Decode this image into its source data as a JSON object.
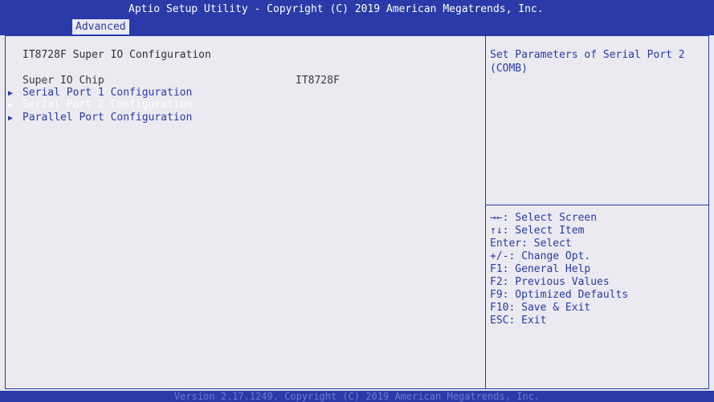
{
  "header": {
    "title": "Aptio Setup Utility - Copyright (C) 2019 American Megatrends, Inc.",
    "active_tab": "Advanced"
  },
  "main": {
    "heading": "IT8728F Super IO Configuration",
    "chip_label": "Super IO Chip",
    "chip_value": "IT8728F",
    "items": [
      {
        "label": "Serial Port 1 Configuration",
        "selected": false
      },
      {
        "label": "Serial Port 2 Configuration",
        "selected": true
      },
      {
        "label": "Parallel Port Configuration",
        "selected": false
      }
    ]
  },
  "help": {
    "text": "Set Parameters of Serial Port 2 (COMB)"
  },
  "keys": [
    "→←: Select Screen",
    "↑↓: Select Item",
    "Enter: Select",
    "+/-: Change Opt.",
    "F1: General Help",
    "F2: Previous Values",
    "F9: Optimized Defaults",
    "F10: Save & Exit",
    "ESC: Exit"
  ],
  "footer": {
    "version": "Version 2.17.1249. Copyright (C) 2019 American Megatrends, Inc."
  },
  "colors": {
    "accent": "#2a3aa8",
    "background": "#e9e9ef",
    "selected_text": "#ffffff"
  }
}
